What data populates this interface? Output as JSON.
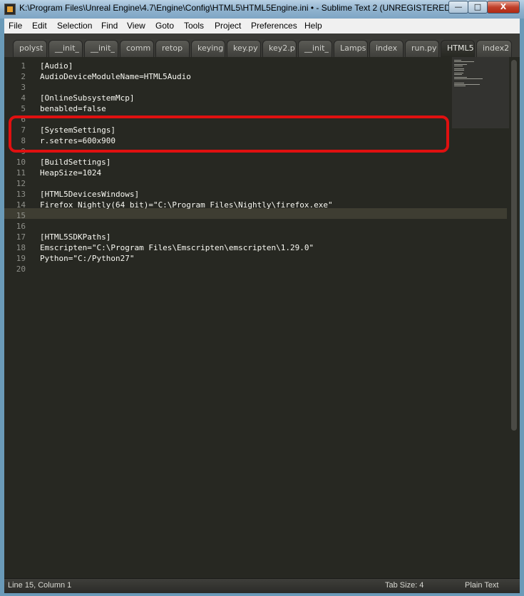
{
  "window": {
    "title": "K:\\Program Files\\Unreal Engine\\4.7\\Engine\\Config\\HTML5\\HTML5Engine.ini • - Sublime Text 2 (UNREGISTERED)",
    "minimize": "—",
    "maximize": "□",
    "close": "X"
  },
  "menu": [
    "File",
    "Edit",
    "Selection",
    "Find",
    "View",
    "Goto",
    "Tools",
    "Project",
    "Preferences",
    "Help"
  ],
  "tabs": [
    "polyst",
    "__init_",
    "__init_",
    "comm",
    "retop",
    "keying",
    "key.py",
    "key2.p",
    "__init_",
    "Lamps",
    "index",
    "run.py",
    "HTML5",
    "index2"
  ],
  "active_tab": 12,
  "lines": [
    "[Audio]",
    "AudioDeviceModuleName=HTML5Audio",
    "",
    "[OnlineSubsystemMcp]",
    "benabled=false",
    "",
    "[SystemSettings]",
    "r.setres=600x900",
    "",
    "[BuildSettings]",
    "HeapSize=1024",
    "",
    "[HTML5DevicesWindows]",
    "Firefox Nightly(64 bit)=\"C:\\Program Files\\Nightly\\firefox.exe\"",
    "",
    "",
    "[HTML5SDKPaths]",
    "Emscripten=\"C:\\Program Files\\Emscripten\\emscripten\\1.29.0\"",
    "Python=\"C:/Python27\"",
    ""
  ],
  "status": {
    "position": "Line 15, Column 1",
    "tab_size": "Tab Size: 4",
    "syntax": "Plain Text"
  },
  "colors": {
    "editor_bg": "#272822",
    "text": "#f8f8f2",
    "gutter_text": "#8f908a",
    "highlight": "#e01010"
  }
}
